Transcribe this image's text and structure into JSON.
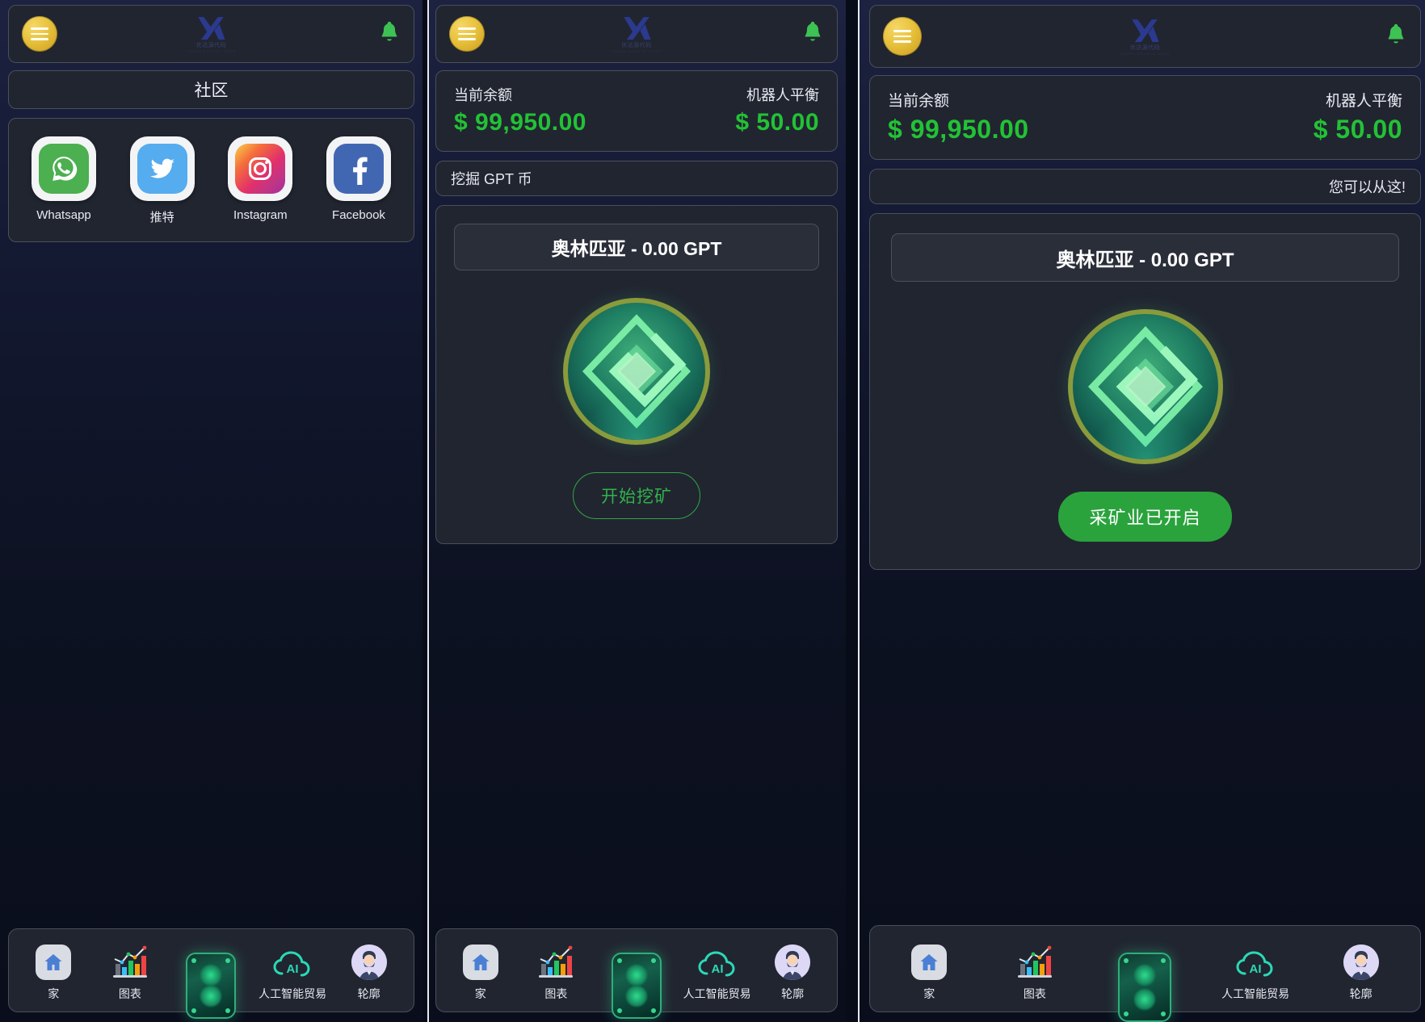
{
  "brand": {
    "logo_name": "yx-logo",
    "logo_sub": "优达源代码",
    "logo_sub2": "YOUDA SOURCE CODE"
  },
  "colors": {
    "accent_green": "#22c235",
    "accent_yellow": "#e8c23c",
    "card_bg": "#212530",
    "page_bg": "#0a0f1f",
    "button_green": "#2aa33c",
    "logo_blue": "#2b3a8f"
  },
  "panel1": {
    "header": {
      "menu_label": "menu",
      "bell_label": "notifications"
    },
    "section_title": "社区",
    "social": [
      {
        "name": "Whatsapp",
        "icon": "whatsapp-icon"
      },
      {
        "name": "推特",
        "icon": "twitter-icon"
      },
      {
        "name": "Instagram",
        "icon": "instagram-icon"
      },
      {
        "name": "Facebook",
        "icon": "facebook-icon"
      }
    ]
  },
  "panel2": {
    "balance": {
      "left_label": "当前余额",
      "left_value": "$ 99,950.00",
      "right_label": "机器人平衡",
      "right_value": "$ 50.00"
    },
    "marquee": "挖掘 GPT 币",
    "mining": {
      "coin_title": "奥林匹亚 - 0.00 GPT",
      "coin_icon": "olympia-coin-icon",
      "button_label": "开始挖矿",
      "button_style": "outline"
    }
  },
  "panel3": {
    "balance": {
      "left_label": "当前余额",
      "left_value": "$ 99,950.00",
      "right_label": "机器人平衡",
      "right_value": "$ 50.00"
    },
    "marquee": "您可以从这!",
    "mining": {
      "coin_title": "奥林匹亚 - 0.00 GPT",
      "coin_icon": "olympia-coin-icon",
      "button_label": "采矿业已开启",
      "button_style": "filled"
    }
  },
  "nav": [
    {
      "label": "家",
      "icon": "home-icon"
    },
    {
      "label": "图表",
      "icon": "chart-icon"
    },
    {
      "label": "",
      "icon": "miner-chip-icon"
    },
    {
      "label": "人工智能贸易",
      "icon": "ai-cloud-icon"
    },
    {
      "label": "轮廓",
      "icon": "profile-avatar-icon"
    }
  ]
}
